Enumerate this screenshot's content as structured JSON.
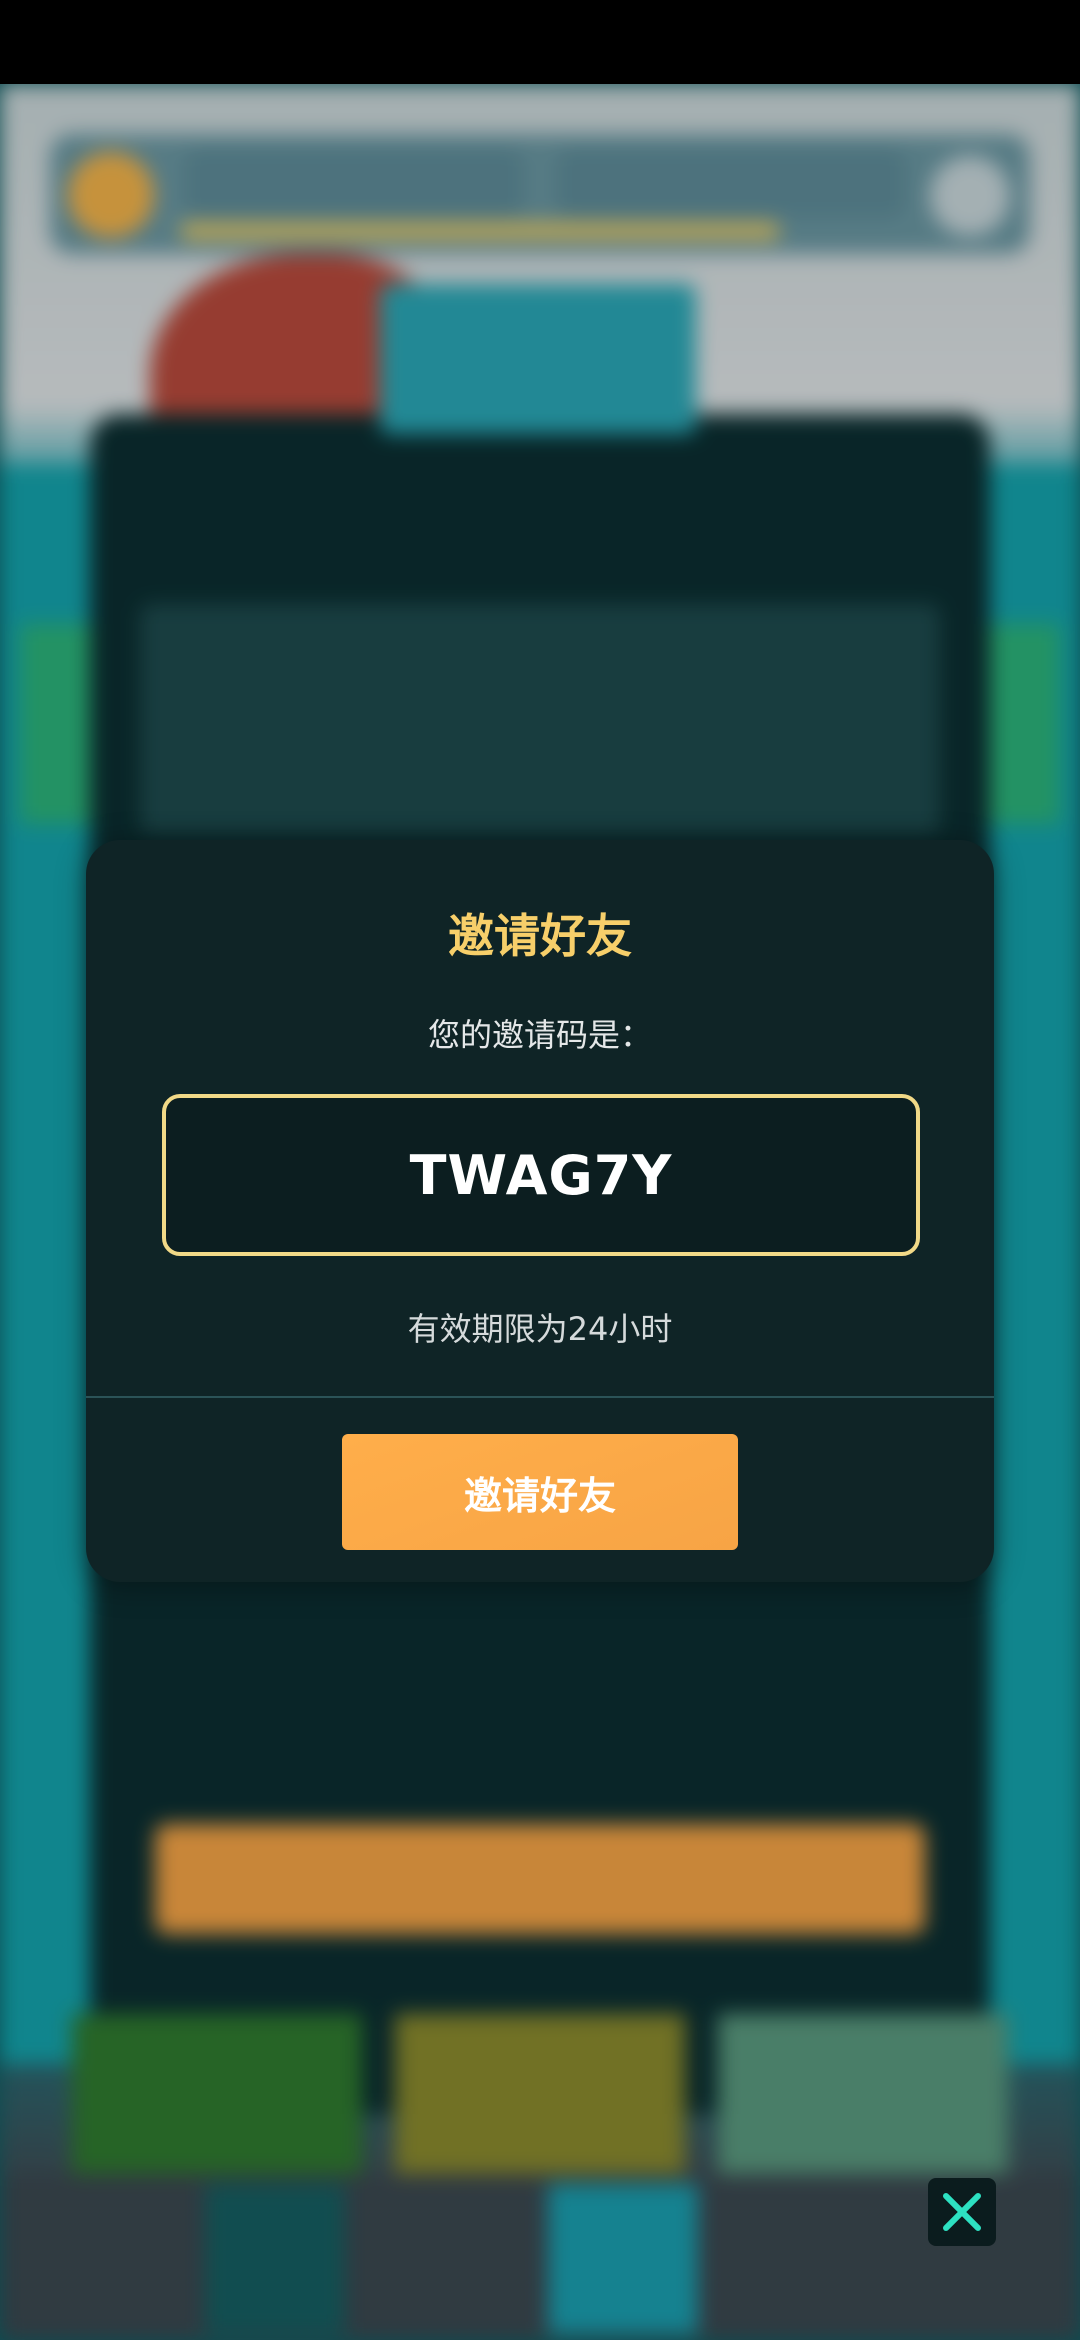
{
  "modal": {
    "title": "邀请好友",
    "subtitle": "您的邀请码是：",
    "invite_code": "TWAG7Y",
    "validity_text": "有效期限为24小时",
    "button_label": "邀请好友"
  },
  "close_button": {
    "icon": "close-icon",
    "color": "#2de1c2"
  },
  "colors": {
    "title": "#f7cf6a",
    "code_border": "#f1d987",
    "button": "#f7a445",
    "modal_bg": "#0f2426"
  }
}
